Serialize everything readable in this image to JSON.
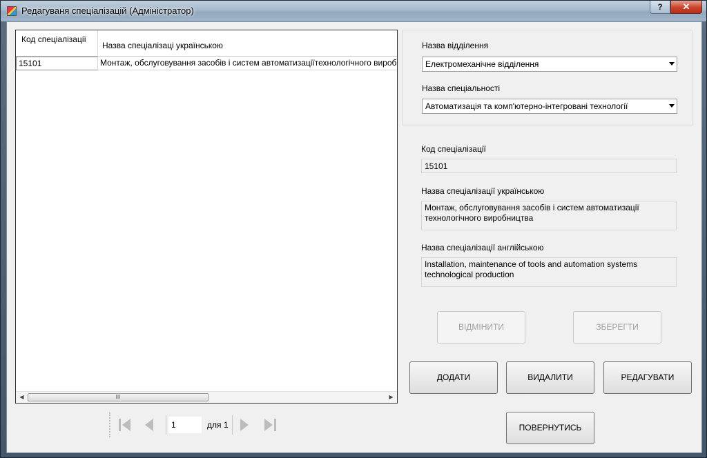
{
  "window": {
    "title": "Редагуваня спеціалізацій (Адміністратор)",
    "help_label": "?",
    "close_label": "✕"
  },
  "grid": {
    "columns": [
      "Код спеціалізації",
      "Назва спеціалізаці українською"
    ],
    "rows": [
      {
        "code": "15101",
        "name": "Монтаж, обслуговування засобів і систем автоматизаціїтехнологічного виробництва"
      }
    ],
    "scroll_thumb": "III"
  },
  "navigator": {
    "position": "1",
    "of_label": "для 1"
  },
  "form": {
    "department_label": "Назва відділення",
    "department_value": "Електромеханічне відділення",
    "specialty_label": "Назва спеціальності",
    "specialty_value": "Автоматизація та комп'ютерно-інтегровані технології",
    "code_label": "Код спеціалізації",
    "code_value": "15101",
    "name_ua_label": "Назва спеціалізації українською",
    "name_ua_value": "Монтаж, обслуговування засобів і систем автоматизації технологічного виробництва",
    "name_en_label": "Назва спеціалізації англійською",
    "name_en_value": "Installation, maintenance of tools and automation systems technological production"
  },
  "buttons": {
    "cancel": "ВІДМІНИТИ",
    "save": "ЗБЕРЕГТИ",
    "add": "ДОДАТИ",
    "delete": "ВИДАЛИТИ",
    "edit": "РЕДАГУВАТИ",
    "back": "ПОВЕРНУТИСЬ"
  }
}
